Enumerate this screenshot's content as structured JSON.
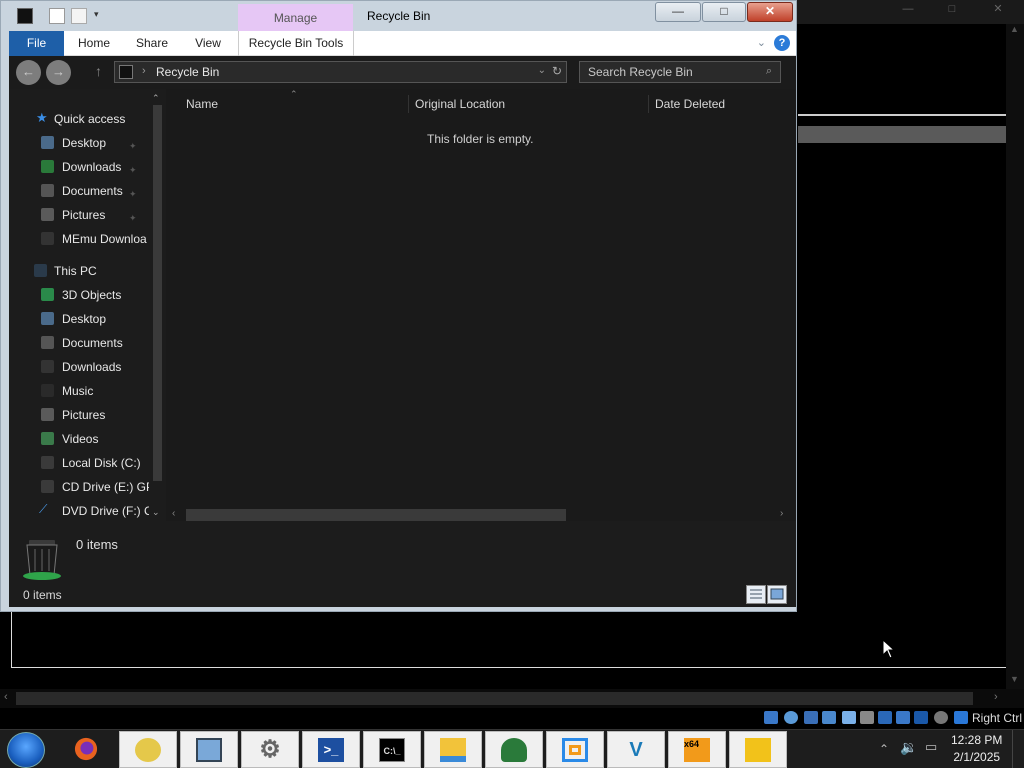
{
  "window": {
    "title": "Recycle Bin",
    "context_tab": "Manage",
    "controls": {
      "minimize": "—",
      "maximize": "□",
      "close": "✕"
    }
  },
  "ribbon": {
    "tabs": [
      "File",
      "Home",
      "Share",
      "View",
      "Recycle Bin Tools"
    ],
    "help": "?"
  },
  "navigation": {
    "back": "←",
    "forward": "→",
    "up": "↑",
    "breadcrumb": "Recycle Bin",
    "search_placeholder": "Search Recycle Bin"
  },
  "nav_pane": {
    "quick_access": {
      "label": "Quick access",
      "items": [
        "Desktop",
        "Downloads",
        "Documents",
        "Pictures",
        "MEmu Downloa"
      ]
    },
    "this_pc": {
      "label": "This PC",
      "items": [
        "3D Objects",
        "Desktop",
        "Documents",
        "Downloads",
        "Music",
        "Pictures",
        "Videos",
        "Local Disk (C:)",
        "CD Drive (E:) GPa",
        "DVD Drive (F:) CC"
      ]
    }
  },
  "content": {
    "columns": [
      "Name",
      "Original Location",
      "Date Deleted"
    ],
    "empty_message": "This folder is empty."
  },
  "details_pane": {
    "count": "0 items"
  },
  "status_bar": {
    "count": "0 items"
  },
  "vm_status": {
    "host_key": "Right Ctrl"
  },
  "taskbar": {
    "apps": [
      "firefox",
      "bee-app",
      "computer-manager",
      "settings",
      "powershell",
      "cmd",
      "file-explorer",
      "network-app",
      "vmware",
      "vs-app",
      "x64-app",
      "puzzle-app"
    ],
    "cmd_glyph": "C:\\_",
    "ps_glyph": ">_",
    "x64_glyph": "x64",
    "clock_time": "12:28 PM",
    "clock_date": "2/1/2025"
  },
  "colors": {
    "file_tab": "#1e5fa8",
    "manage_tab": "#e6c7f5",
    "window_frame": "#c9d4de",
    "dark_pane": "#1c1c1c",
    "close_button": "#c0412a"
  }
}
